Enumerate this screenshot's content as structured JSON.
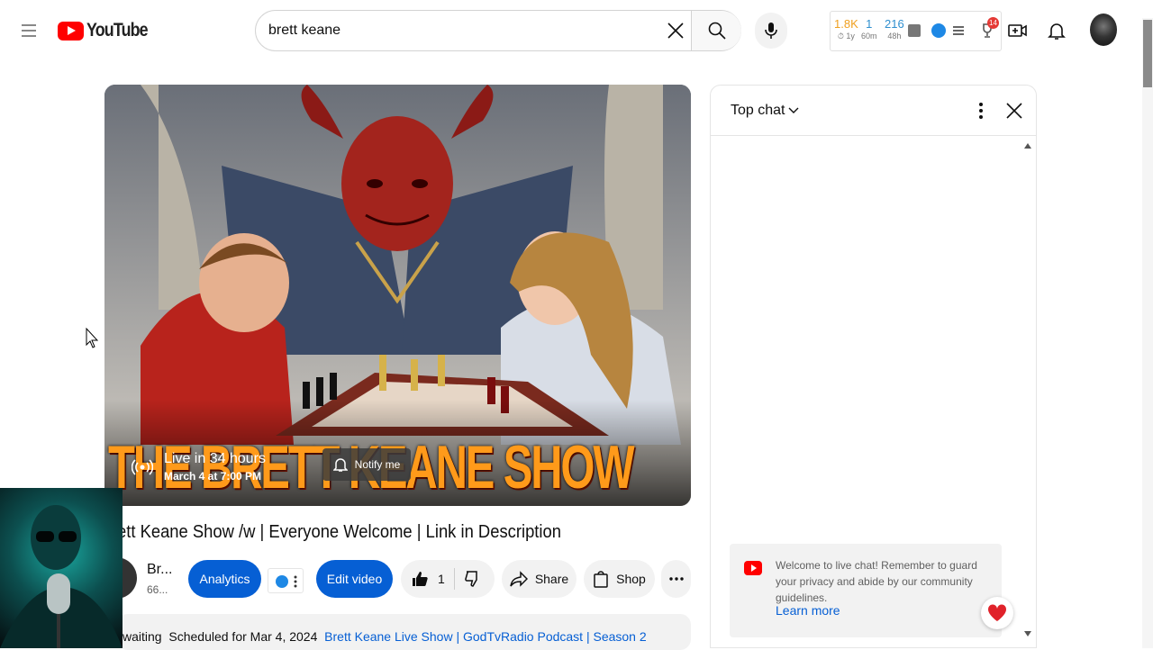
{
  "header": {
    "logo_text": "YouTube",
    "search": {
      "value": "brett keane"
    },
    "extension_stats": {
      "views": {
        "value": "1.8K",
        "caption": "1y"
      },
      "live": {
        "value": "1",
        "caption": "60m"
      },
      "recent": {
        "value": "216",
        "caption": "48h"
      },
      "badge_count": "14"
    }
  },
  "player": {
    "live_status": "Live in 34 hours",
    "scheduled_time": "March 4 at 7:00 PM",
    "notify_label": "Notify me",
    "thumbnail_title": "THE BRETT KEANE SHOW"
  },
  "video": {
    "title": "ett Keane Show /w | Everyone Welcome | Link in Description",
    "channel_name": "Br...",
    "subscribers": "66...",
    "analytics_label": "Analytics",
    "edit_label": "Edit video",
    "like_count": "1",
    "share_label": "Share",
    "shop_label": "Shop",
    "description": {
      "prefix": "waiting",
      "scheduled": "Scheduled for Mar 4, 2024",
      "link": "Brett Keane Live Show | GodTvRadio Podcast | Season 2"
    }
  },
  "chat": {
    "header_label": "Top chat",
    "welcome_text": "Welcome to live chat! Remember to guard your privacy and abide by our community guidelines.",
    "learn_more": "Learn more"
  },
  "colors": {
    "brand_red": "#ff0000",
    "accent_blue": "#065fd4"
  }
}
